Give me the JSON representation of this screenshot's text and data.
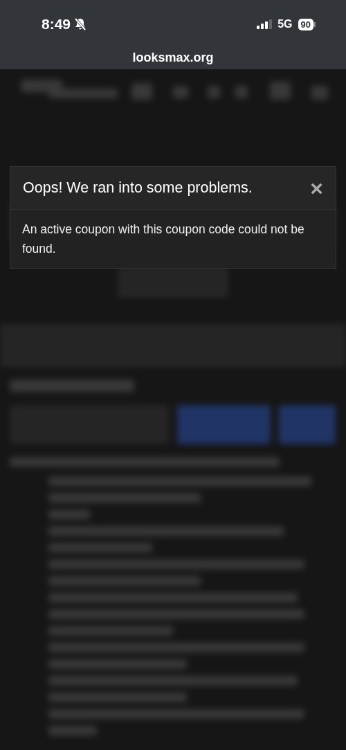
{
  "status_bar": {
    "time": "8:49",
    "silent": true,
    "network": "5G",
    "battery": "90"
  },
  "address_bar": {
    "url": "looksmax.org"
  },
  "dialog": {
    "title": "Oops! We ran into some problems.",
    "close": "×",
    "message": "An active coupon with this coupon code could not be found."
  }
}
